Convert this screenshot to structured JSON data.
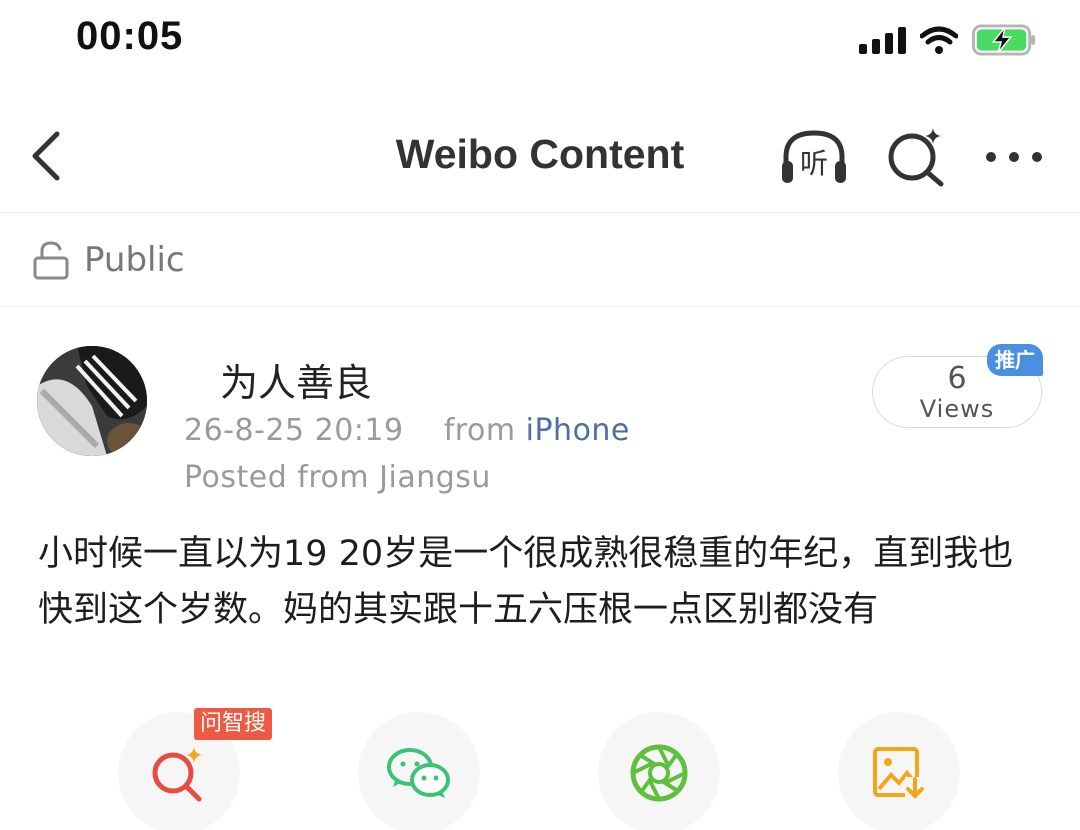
{
  "status_bar": {
    "time": "00:05",
    "icons": [
      "cellular-signal-icon",
      "wifi-icon",
      "battery-charging-icon"
    ],
    "battery_color": "#4cd964"
  },
  "nav": {
    "title": "Weibo Content",
    "listen_glyph": "听",
    "icons": [
      "back-arrow-icon",
      "listen-headphones-icon",
      "ai-search-icon",
      "more-icon"
    ]
  },
  "visibility": {
    "icon": "lock-open-icon",
    "label": "Public"
  },
  "post": {
    "username": "为人善良",
    "date": "26-8-25 20:19",
    "from_word": "from",
    "source": "iPhone",
    "location": "Posted from Jiangsu",
    "views_count": "6",
    "views_label": "Views",
    "ad_badge": "推广",
    "text": "小时候一直以为19 20岁是一个很成熟很稳重的年纪，直到我也快到这个岁数。妈的其实跟十五六压根一点区别都没有"
  },
  "share": {
    "ai_badge": "问智搜",
    "buttons": [
      "ai-search-icon",
      "wechat-icon",
      "moments-icon",
      "save-image-icon"
    ]
  },
  "colors": {
    "link_blue": "#4c6fa5",
    "ad_blue": "#4a8fe0",
    "ai_red": "#ec5a43",
    "wechat_green": "#3cc276",
    "moments_green": "#5ec03d",
    "save_orange": "#f3a619"
  }
}
